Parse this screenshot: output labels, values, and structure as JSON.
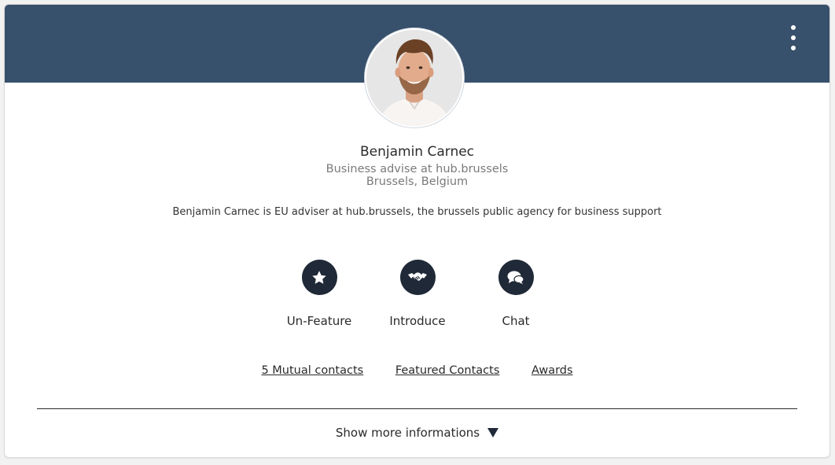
{
  "profile": {
    "name": "Benjamin Carnec",
    "role": "Business advise at hub.brussels",
    "location": "Brussels, Belgium",
    "bio": "Benjamin Carnec is EU adviser at hub.brussels, the brussels public agency for business support"
  },
  "actions": {
    "feature_label": "Un-Feature",
    "introduce_label": "Introduce",
    "chat_label": "Chat"
  },
  "links": {
    "mutual": "5 Mutual contacts",
    "featured": "Featured Contacts",
    "awards": "Awards"
  },
  "footer": {
    "show_more": "Show more informations"
  },
  "icons": {
    "menu": "more-vertical-icon",
    "feature": "star-icon",
    "introduce": "handshake-icon",
    "chat": "chat-bubbles-icon",
    "expand": "triangle-down-icon"
  },
  "colors": {
    "banner": "#37506b",
    "icon_circle": "#1f2937",
    "muted_text": "#7a7a7a"
  }
}
